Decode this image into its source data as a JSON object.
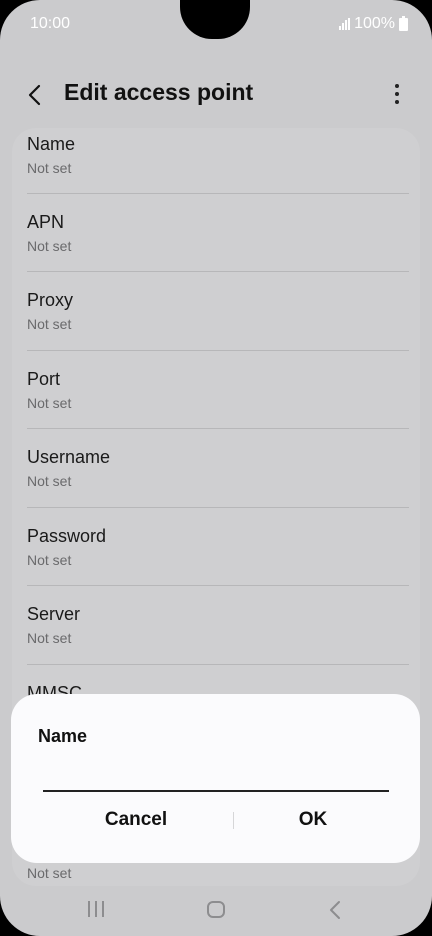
{
  "status_bar": {
    "time": "10:00",
    "battery": "100%"
  },
  "app_bar": {
    "title": "Edit access point"
  },
  "list": {
    "items": [
      {
        "title": "Name",
        "subtitle": "Not set"
      },
      {
        "title": "APN",
        "subtitle": "Not set"
      },
      {
        "title": "Proxy",
        "subtitle": "Not set"
      },
      {
        "title": "Port",
        "subtitle": "Not set"
      },
      {
        "title": "Username",
        "subtitle": "Not set"
      },
      {
        "title": "Password",
        "subtitle": "Not set"
      },
      {
        "title": "Server",
        "subtitle": "Not set"
      },
      {
        "title": "MMSC",
        "subtitle": "Not set"
      }
    ]
  },
  "dialog": {
    "title": "Name",
    "input_value": "",
    "cancel_label": "Cancel",
    "ok_label": "OK"
  },
  "icons": {
    "back": "chevron-left-icon",
    "more": "more-vertical-icon",
    "signal": "signal-icon",
    "battery": "battery-icon",
    "nav_recents": "recents-icon",
    "nav_home": "home-icon",
    "nav_back": "nav-back-icon"
  }
}
